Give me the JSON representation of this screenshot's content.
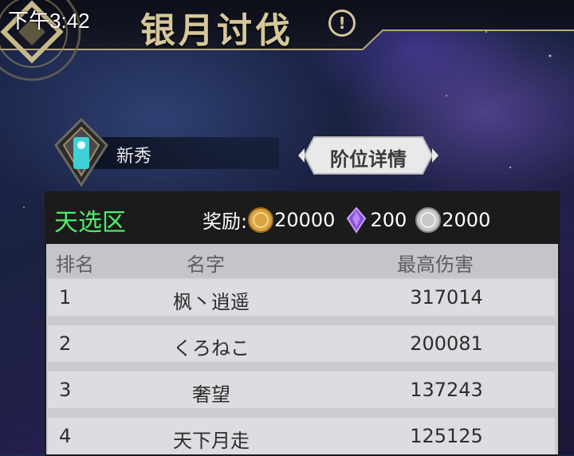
{
  "status_bar": {
    "time": "下午3:42"
  },
  "header": {
    "title": "银月讨伐",
    "info_symbol": "!"
  },
  "rank": {
    "tier_label": "新秀",
    "detail_button": "阶位详情"
  },
  "panel": {
    "zone_name": "天选区",
    "rewards_label": "奖励:",
    "rewards": [
      {
        "icon": "gold-coin-icon",
        "amount": "20000",
        "color": "#d9a441"
      },
      {
        "icon": "purple-crystal-icon",
        "amount": "200",
        "color": "#8a4dd6"
      },
      {
        "icon": "silver-coin-icon",
        "amount": "2000",
        "color": "#c7c7c7"
      }
    ],
    "columns": {
      "rank": "排名",
      "name": "名字",
      "damage": "最高伤害"
    },
    "rows": [
      {
        "rank": "1",
        "name": "枫丶逍遥",
        "damage": "317014"
      },
      {
        "rank": "2",
        "name": "くろねこ",
        "damage": "200081"
      },
      {
        "rank": "3",
        "name": "奢望",
        "damage": "137243"
      },
      {
        "rank": "4",
        "name": "天下月走",
        "damage": "125125"
      }
    ]
  }
}
